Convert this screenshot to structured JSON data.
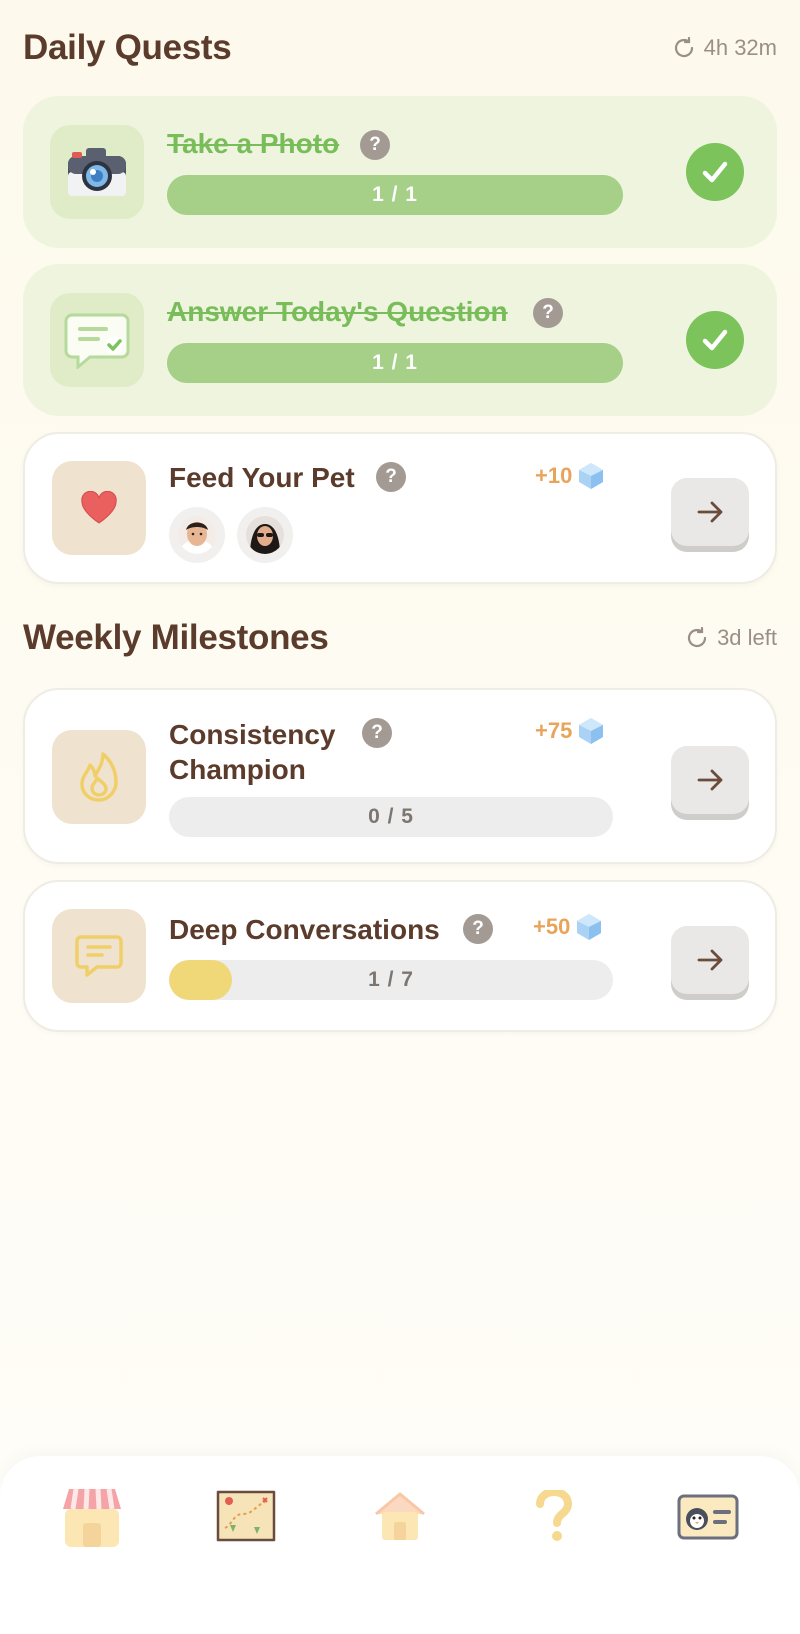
{
  "daily": {
    "title": "Daily Quests",
    "timer": "4h 32m",
    "quests": [
      {
        "title": "Take a Photo",
        "progress": "1 / 1",
        "completed": true,
        "icon": "camera-icon"
      },
      {
        "title": "Answer Today's Question",
        "progress": "1 / 1",
        "completed": true,
        "icon": "chat-check-icon"
      },
      {
        "title": "Feed Your Pet",
        "reward": "+10",
        "completed": false,
        "icon": "heart-icon"
      }
    ]
  },
  "weekly": {
    "title": "Weekly Milestones",
    "timer": "3d left",
    "milestones": [
      {
        "title": "Consistency Champion",
        "reward": "+75",
        "progress": "0 / 5",
        "fraction": 0.0,
        "icon": "flame-icon"
      },
      {
        "title": "Deep Conversations",
        "reward": "+50",
        "progress": "1 / 7",
        "fraction": 0.143,
        "icon": "message-icon"
      }
    ]
  },
  "help_glyph": "?",
  "colors": {
    "accent_green": "#7bc35a",
    "reward_orange": "#e9a45c",
    "progress_yellow": "#f0d778",
    "title_brown": "#5b3b2b"
  },
  "tabbar": {
    "tabs": [
      {
        "icon": "shop-icon"
      },
      {
        "icon": "map-icon"
      },
      {
        "icon": "home-icon"
      },
      {
        "icon": "question-icon"
      },
      {
        "icon": "profile-card-icon"
      }
    ]
  }
}
